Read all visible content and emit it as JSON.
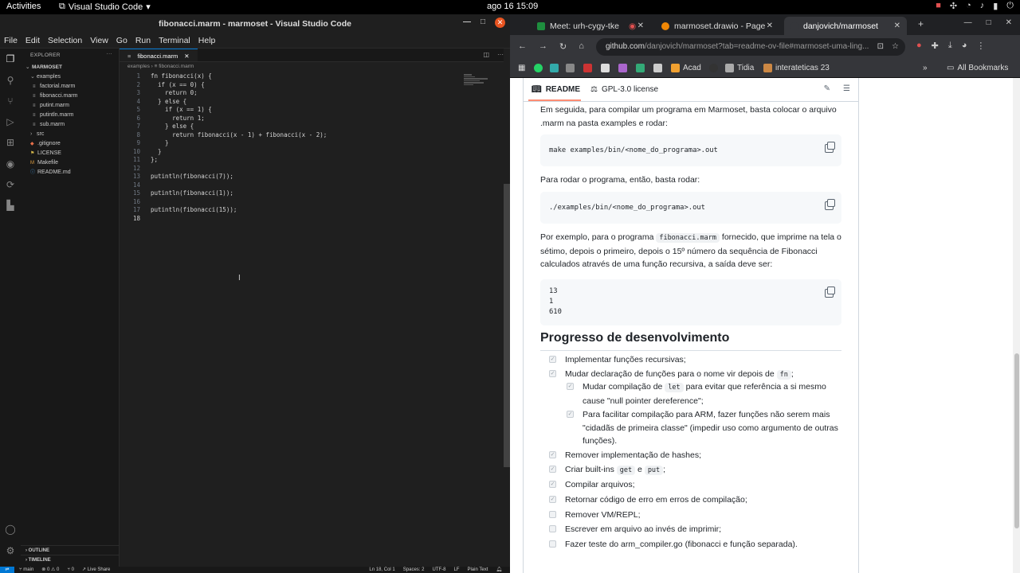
{
  "topbar": {
    "activities": "Activities",
    "app_name": "Visual Studio Code",
    "clock": "ago 16  15:09"
  },
  "vscode": {
    "window_title": "fibonacci.marm - marmoset - Visual Studio Code",
    "menu": [
      "File",
      "Edit",
      "Selection",
      "View",
      "Go",
      "Run",
      "Terminal",
      "Help"
    ],
    "explorer_label": "EXPLORER",
    "root_folder": "MARMOSET",
    "tree": [
      {
        "label": "examples",
        "kind": "folder-open",
        "depth": 1
      },
      {
        "label": "factorial.marm",
        "kind": "file",
        "depth": 2
      },
      {
        "label": "fibonacci.marm",
        "kind": "file",
        "depth": 2
      },
      {
        "label": "putint.marm",
        "kind": "file",
        "depth": 2
      },
      {
        "label": "putintln.marm",
        "kind": "file",
        "depth": 2
      },
      {
        "label": "sub.marm",
        "kind": "file",
        "depth": 2
      },
      {
        "label": "src",
        "kind": "folder",
        "depth": 1
      },
      {
        "label": ".gitignore",
        "kind": "file",
        "depth": 1
      },
      {
        "label": "LICENSE",
        "kind": "file",
        "depth": 1
      },
      {
        "label": "Makefile",
        "kind": "file",
        "depth": 1
      },
      {
        "label": "README.md",
        "kind": "file",
        "depth": 1
      }
    ],
    "outline_label": "OUTLINE",
    "timeline_label": "TIMELINE",
    "tab_label": "fibonacci.marm",
    "breadcrumb_folder": "examples",
    "breadcrumb_file": "fibonacci.marm",
    "code_lines": [
      "fn fibonacci(x) {",
      "  if (x == 0) {",
      "    return 0;",
      "  } else {",
      "    if (x == 1) {",
      "      return 1;",
      "    } else {",
      "      return fibonacci(x - 1) + fibonacci(x - 2);",
      "    }",
      "  }",
      "};",
      "",
      "putintln(fibonacci(7));",
      "",
      "putintln(fibonacci(1));",
      "",
      "putintln(fibonacci(15));",
      ""
    ],
    "status": {
      "branch": "main",
      "problems": "⊗ 0 ⚠ 0",
      "ports": "⑂ 0",
      "live_share": "Live Share",
      "position": "Ln 18, Col 1",
      "spaces": "Spaces: 2",
      "encoding": "UTF-8",
      "eol": "LF",
      "language": "Plain Text"
    }
  },
  "chrome": {
    "tabs": [
      {
        "label": "Meet: urh-cygy-tke",
        "active": false
      },
      {
        "label": "marmoset.drawio - Page",
        "active": false
      },
      {
        "label": "danjovich/marmoset",
        "active": true
      }
    ],
    "url_host": "github.com",
    "url_path": "/danjovich/marmoset?tab=readme-ov-file#marmoset-uma-ling...",
    "bookmarks": [
      "Acad",
      "Tidia",
      "interateticas 23"
    ],
    "all_bookmarks": "All Bookmarks",
    "readme_tab": "README",
    "license_tab": "GPL-3.0 license",
    "p1": "Em seguida, para compilar um programa em Marmoset, basta colocar o arquivo .marm na pasta examples e rodar:",
    "code1": "make examples/bin/<nome_do_programa>.out",
    "p2": "Para rodar o programa, então, basta rodar:",
    "code2": "./examples/bin/<nome_do_programa>.out",
    "p3_before": "Por exemplo, para o programa ",
    "p3_code": "fibonacci.marm",
    "p3_after": " fornecido, que imprime na tela o sétimo, depois o primeiro, depois o 15º número da sequência de Fibonacci calculados através de uma função recursiva, a saída deve ser:",
    "output_lines": [
      "13",
      "1",
      "610"
    ],
    "h2": "Progresso de desenvolvimento",
    "tasks": [
      {
        "text": "Implementar funções recursivas;",
        "checked": true,
        "depth": 0
      },
      {
        "text": "Mudar declaração de funções para o nome vir depois de ",
        "code": "fn",
        "after": ";",
        "checked": true,
        "depth": 0
      },
      {
        "text": "Mudar compilação de ",
        "code": "let",
        "after": " para evitar que referência a si mesmo",
        "line2": "cause \"null pointer dereference\";",
        "checked": true,
        "depth": 1
      },
      {
        "text": "Para facilitar compilação para ARM, fazer funções não serem mais",
        "line2": "\"cidadãs de primeira classe\" (impedir uso como argumento de outras",
        "line3": "funções).",
        "checked": true,
        "depth": 1
      },
      {
        "text": "Remover implementação de hashes;",
        "checked": true,
        "depth": 0
      },
      {
        "text": "Criar built-ins ",
        "code": "get",
        "mid": " e ",
        "code2": "put",
        "after": ";",
        "checked": true,
        "depth": 0
      },
      {
        "text": "Compilar arquivos;",
        "checked": true,
        "depth": 0
      },
      {
        "text": "Retornar código de erro em erros de compilação;",
        "checked": true,
        "depth": 0
      },
      {
        "text": "Remover VM/REPL;",
        "checked": false,
        "depth": 0
      },
      {
        "text": "Escrever em arquivo ao invés de imprimir;",
        "checked": false,
        "depth": 0
      },
      {
        "text": "Fazer teste do arm_compiler.go (fibonacci e função separada).",
        "checked": false,
        "depth": 0
      }
    ]
  }
}
